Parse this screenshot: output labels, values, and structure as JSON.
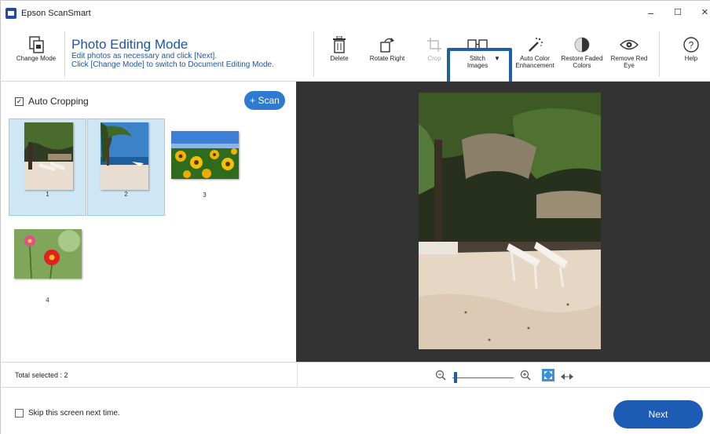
{
  "window": {
    "title": "Epson ScanSmart",
    "minimize": "–",
    "maximize": "☐",
    "close": "×"
  },
  "toolbar": {
    "change_mode": "Change Mode",
    "mode_title": "Photo Editing Mode",
    "mode_line1": "Edit photos as necessary and click [Next].",
    "mode_line2": "Click [Change Mode] to switch to Document Editing Mode.",
    "delete": "Delete",
    "rotate_right": "Rotate Right",
    "crop": "Crop",
    "stitch_images": "Stitch\nImages",
    "auto_color": "Auto Color\nEnhancement",
    "restore_faded": "Restore Faded\nColors",
    "remove_red_eye": "Remove Red\nEye",
    "help": "Help"
  },
  "left_pane": {
    "auto_cropping_label": "Auto Cropping",
    "auto_cropping_checked": true,
    "scan_button": "+ Scan",
    "thumbnails": [
      {
        "number": "1",
        "selected": true,
        "subject": "beach chairs"
      },
      {
        "number": "2",
        "selected": true,
        "subject": "palm beach"
      },
      {
        "number": "3",
        "selected": false,
        "subject": "sunflowers"
      },
      {
        "number": "4",
        "selected": false,
        "subject": "flowers"
      }
    ]
  },
  "status": {
    "total_selected": "Total selected : 2",
    "zoom_out_icon": "zoom-out-icon",
    "zoom_in_icon": "zoom-in-icon",
    "fit_icon": "fit-to-window-icon",
    "actual_size_icon": "actual-size-icon"
  },
  "footer": {
    "skip_label": "Skip this screen next time.",
    "skip_checked": false,
    "next_button": "Next"
  },
  "colors": {
    "accent": "#1d5cb5",
    "preview_bg": "#333333",
    "selection": "#cfe6f5"
  }
}
